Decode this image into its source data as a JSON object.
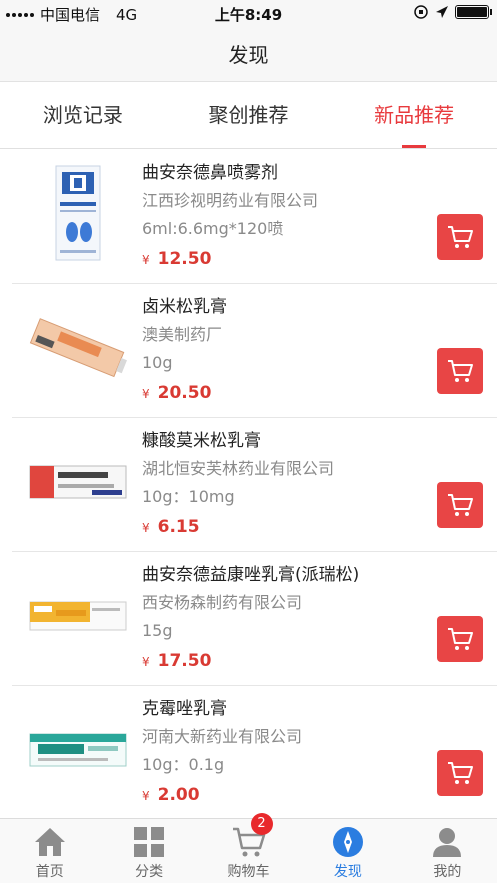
{
  "status_bar": {
    "carrier": "中国电信",
    "network": "4G",
    "time": "上午8:49",
    "battery_level": 1.0
  },
  "header": {
    "title": "发现"
  },
  "tabs": [
    {
      "label": "浏览记录",
      "active": false
    },
    {
      "label": "聚创推荐",
      "active": false
    },
    {
      "label": "新品推荐",
      "active": true
    }
  ],
  "products": [
    {
      "name": "曲安奈德鼻喷雾剂",
      "maker": "江西珍视明药业有限公司",
      "spec": "6ml:6.6mg*120喷",
      "currency": "¥",
      "price": "12.50",
      "image_icon": "nasal-spray-box-image"
    },
    {
      "name": "卤米松乳膏",
      "maker": "澳美制药厂",
      "spec": "10g",
      "currency": "¥",
      "price": "20.50",
      "image_icon": "ointment-tube-image"
    },
    {
      "name": "糠酸莫米松乳膏",
      "maker": "湖北恒安芙林药业有限公司",
      "spec": "10g：10mg",
      "currency": "¥",
      "price": "6.15",
      "image_icon": "cream-box-image"
    },
    {
      "name": "曲安奈德益康唑乳膏(派瑞松)",
      "maker": "西安杨森制药有限公司",
      "spec": "15g",
      "currency": "¥",
      "price": "17.50",
      "image_icon": "cream-box-image"
    },
    {
      "name": "克霉唑乳膏",
      "maker": "河南大新药业有限公司",
      "spec": "10g：0.1g",
      "currency": "¥",
      "price": "2.00",
      "image_icon": "cream-box-image"
    }
  ],
  "tabbar": [
    {
      "label": "首页",
      "icon": "home-icon",
      "active": false
    },
    {
      "label": "分类",
      "icon": "grid-icon",
      "active": false
    },
    {
      "label": "购物车",
      "icon": "cart-icon",
      "active": false,
      "badge": "2"
    },
    {
      "label": "发现",
      "icon": "compass-icon",
      "active": true
    },
    {
      "label": "我的",
      "icon": "user-icon",
      "active": false
    }
  ],
  "colors": {
    "accent": "#e83a3d",
    "active_tab": "#2b7de0",
    "cart_button": "#e84545"
  }
}
